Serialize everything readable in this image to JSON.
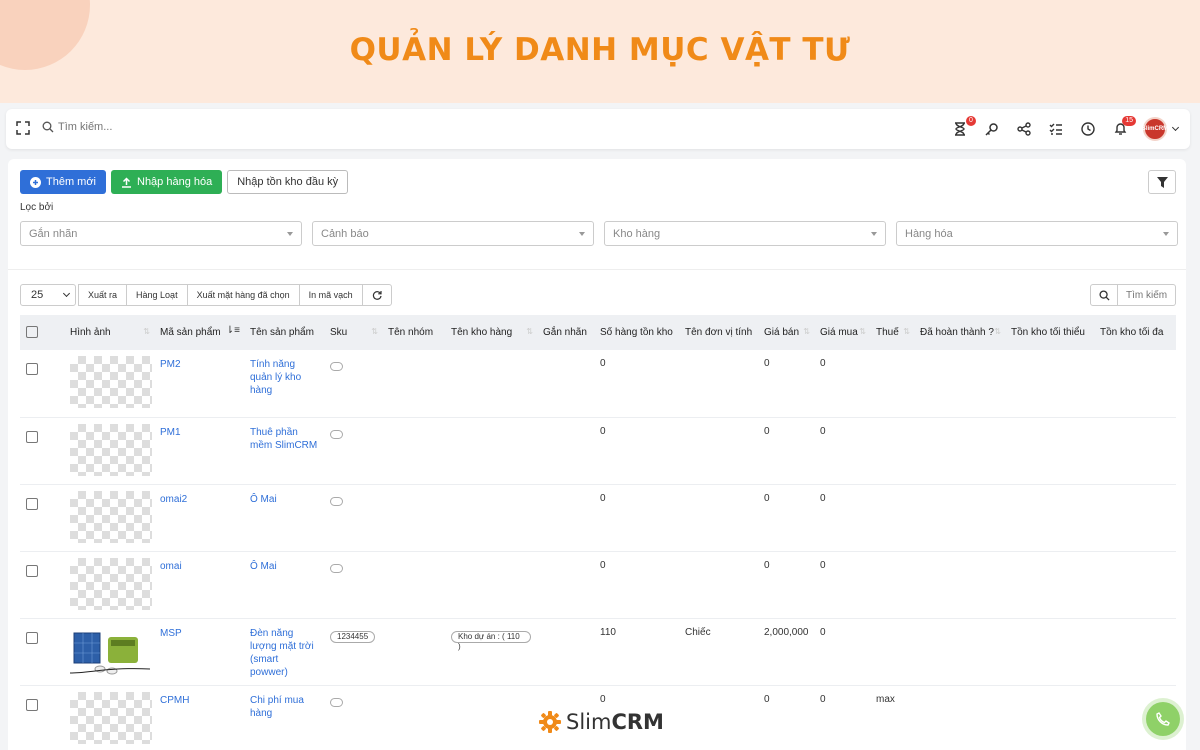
{
  "banner": {
    "title": "QUẢN LÝ DANH MỤC VẬT TƯ"
  },
  "topbar": {
    "search_placeholder": "Tìm kiếm...",
    "timer_badge": "0",
    "notification_badge": "15",
    "avatar_text": "SlimCRM"
  },
  "actions": {
    "add_label": "Thêm mới",
    "import_label": "Nhập hàng hóa",
    "opening_stock_label": "Nhập tồn kho đầu kỳ"
  },
  "filters": {
    "label": "Lọc bởi",
    "tag": "Gắn nhãn",
    "warning": "Cảnh báo",
    "warehouse": "Kho hàng",
    "goods": "Hàng hóa"
  },
  "table_tools": {
    "page_size": "25",
    "export": "Xuất ra",
    "bulk": "Hàng Loạt",
    "export_selected": "Xuất mặt hàng đã chọn",
    "print_barcode": "In mã vạch",
    "search_placeholder": "Tìm kiếm"
  },
  "columns": {
    "image": "Hình ảnh",
    "code": "Mã sản phẩm",
    "name": "Tên sản phẩm",
    "sku": "Sku",
    "group": "Tên nhóm",
    "warehouse": "Tên kho hàng",
    "tag": "Gắn nhãn",
    "stock": "Số hàng tồn kho",
    "unit": "Tên đơn vị tính",
    "price": "Giá bán",
    "cost": "Giá mua",
    "tax": "Thuế",
    "done": "Đã hoàn thành ?",
    "min_stock": "Tồn kho tối thiểu",
    "max_stock": "Tồn kho tối đa"
  },
  "rows": [
    {
      "code": "PM2",
      "name": "Tính năng quản lý kho hàng",
      "sku": "",
      "warehouse": "",
      "stock": "0",
      "unit": "",
      "price": "0",
      "cost": "0",
      "tax": "",
      "image": "placeholder"
    },
    {
      "code": "PM1",
      "name": "Thuê phần mềm SlimCRM",
      "sku": "",
      "warehouse": "",
      "stock": "0",
      "unit": "",
      "price": "0",
      "cost": "0",
      "tax": "",
      "image": "placeholder"
    },
    {
      "code": "omai2",
      "name": "Ô Mai",
      "sku": "",
      "warehouse": "",
      "stock": "0",
      "unit": "",
      "price": "0",
      "cost": "0",
      "tax": "",
      "image": "placeholder"
    },
    {
      "code": "omai",
      "name": "Ô Mai",
      "sku": "",
      "warehouse": "",
      "stock": "0",
      "unit": "",
      "price": "0",
      "cost": "0",
      "tax": "",
      "image": "placeholder"
    },
    {
      "code": "MSP",
      "name": "Đèn năng lượng mặt trời (smart powwer)",
      "sku": "1234455",
      "warehouse": "Kho dự án : ( 110 )",
      "stock": "110",
      "unit": "Chiếc",
      "price": "2,000,000",
      "cost": "0",
      "tax": "",
      "image": "solar-kit"
    },
    {
      "code": "CPMH",
      "name": "Chi phí mua hàng",
      "sku": "",
      "warehouse": "",
      "stock": "0",
      "unit": "",
      "price": "0",
      "cost": "0",
      "tax": "max",
      "image": "placeholder"
    }
  ],
  "footer": {
    "brand_light": "Slim",
    "brand_bold": "CRM"
  },
  "colors": {
    "accent": "#2f6fd8",
    "success": "#2eaf55",
    "banner_title": "#f08a18",
    "call_button": "#8fd168"
  }
}
